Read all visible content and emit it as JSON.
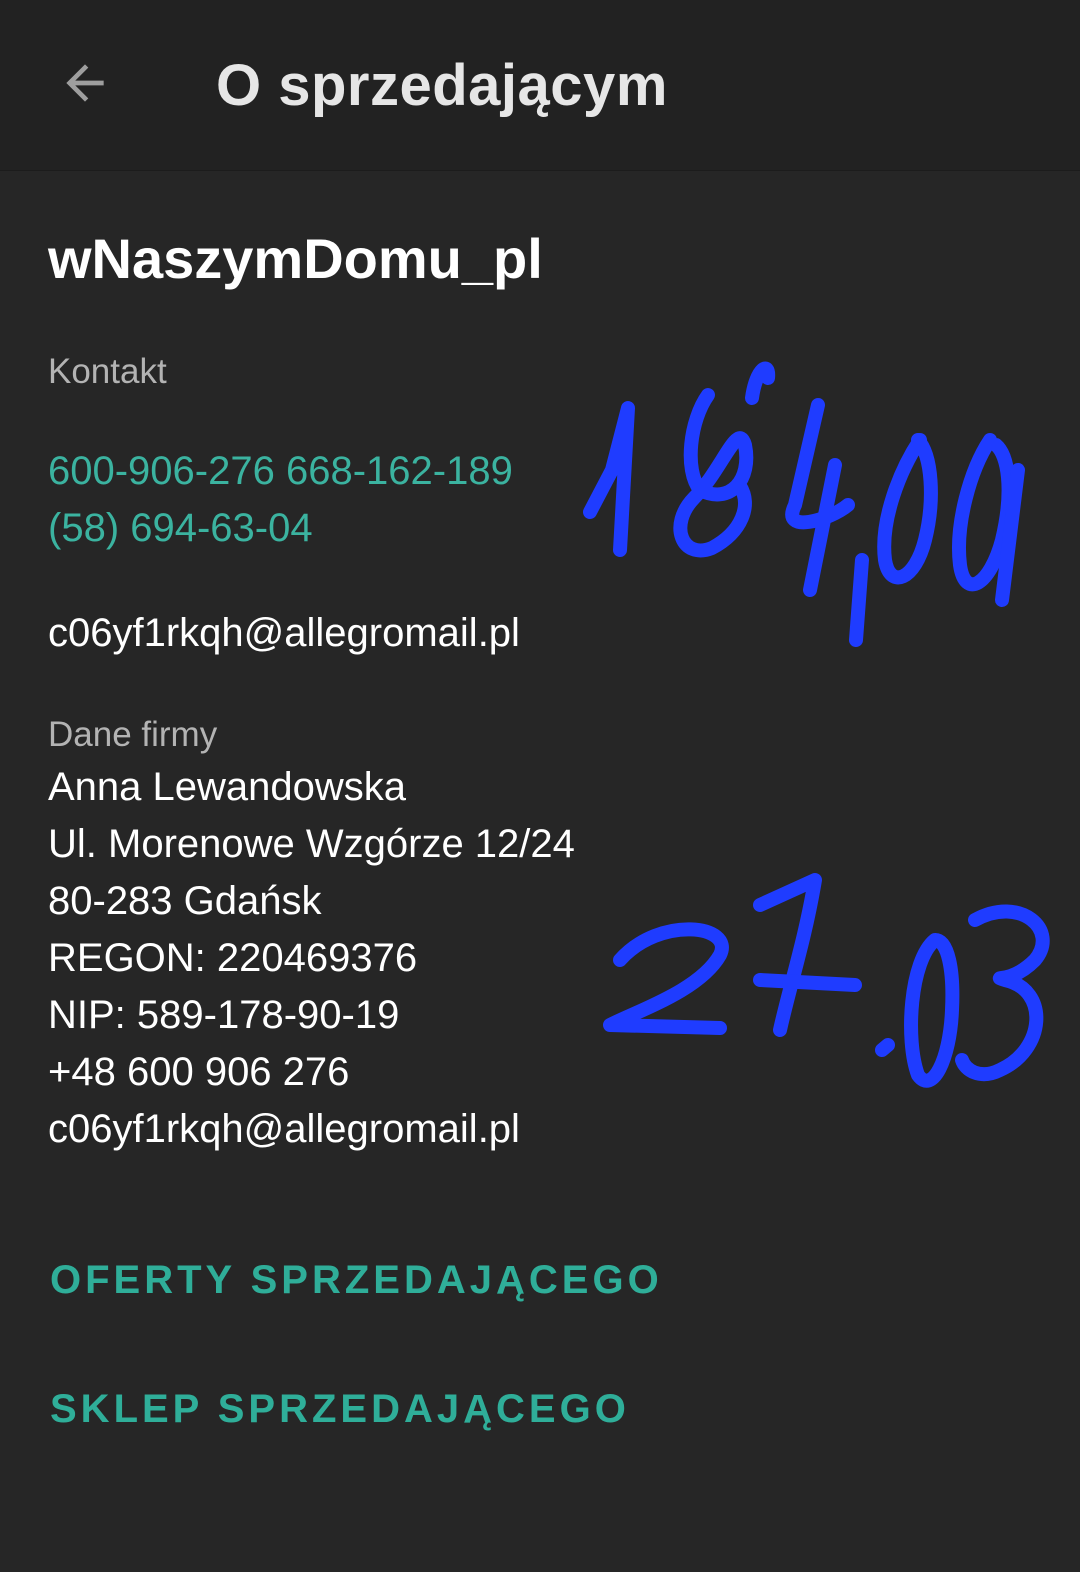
{
  "appbar": {
    "back_icon": "arrow-back-icon",
    "title": "O sprzedającym"
  },
  "seller": {
    "name": "wNaszymDomu_pl"
  },
  "contact": {
    "label": "Kontakt",
    "phone1": "600-906-276",
    "phone2": "668-162-189",
    "phone3": "(58) 694-63-04",
    "email": "c06yf1rkqh@allegromail.pl"
  },
  "company": {
    "label": "Dane firmy",
    "name": "Anna Lewandowska",
    "street": "Ul. Morenowe Wzgórze 12/24",
    "city": "80-283 Gdańsk",
    "regon": "REGON: 220469376",
    "nip": "NIP: 589-178-90-19",
    "phone": "+48 600 906 276",
    "email": "c06yf1rkqh@allegromail.pl"
  },
  "actions": {
    "offers": "OFERTY SPRZEDAJĄCEGO",
    "shop": "SKLEP SPRZEDAJĄCEGO"
  },
  "annotations": {
    "note1": "184,00",
    "note2": "27.03",
    "color": "#1f3cff"
  },
  "colors": {
    "background": "#262626",
    "appbar": "#222222",
    "accent": "#3bb3a0",
    "secondary_text": "#b3b3b3"
  }
}
